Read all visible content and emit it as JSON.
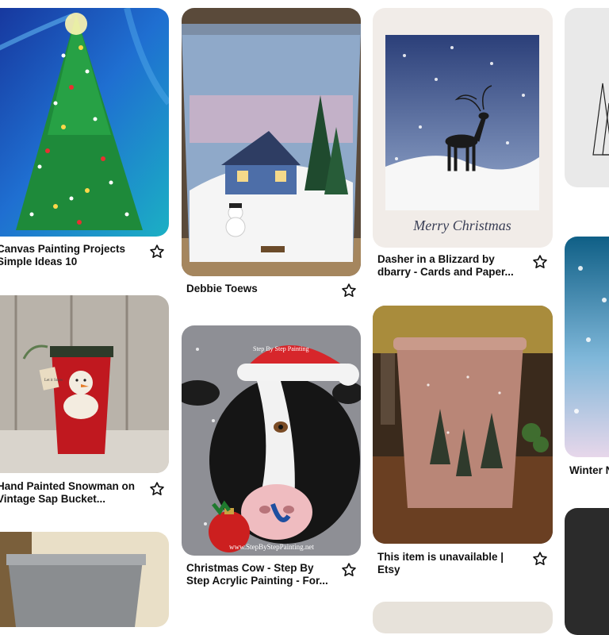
{
  "pins": [
    {
      "id": "p1",
      "title": "Canvas Painting Projects\nSimple Ideas 10",
      "saved": false
    },
    {
      "id": "p2",
      "title": "Debbie Toews",
      "saved": false
    },
    {
      "id": "p3",
      "title": "Dasher in a Blizzard by\ndbarry - Cards and Paper...",
      "saved": false,
      "card_text": "Merry Christmas"
    },
    {
      "id": "p4",
      "title": "Hand Painted Snowman on\nVintage Sap Bucket...",
      "saved": false,
      "tag_text": "Let it Snow"
    },
    {
      "id": "p5",
      "title": "Christmas Cow - Step By\nStep Acrylic Painting - For...",
      "saved": false,
      "watermark_top": "Step By Step Painting",
      "watermark_bottom": "www.StepByStepPainting.net"
    },
    {
      "id": "p6",
      "title": "This item is unavailable |\nEtsy",
      "saved": false
    },
    {
      "id": "p7",
      "title": "Winter N",
      "saved": false
    }
  ],
  "icons": {
    "save": "star-outline-icon"
  },
  "colors": {
    "text": "#111111",
    "background": "#ffffff"
  }
}
